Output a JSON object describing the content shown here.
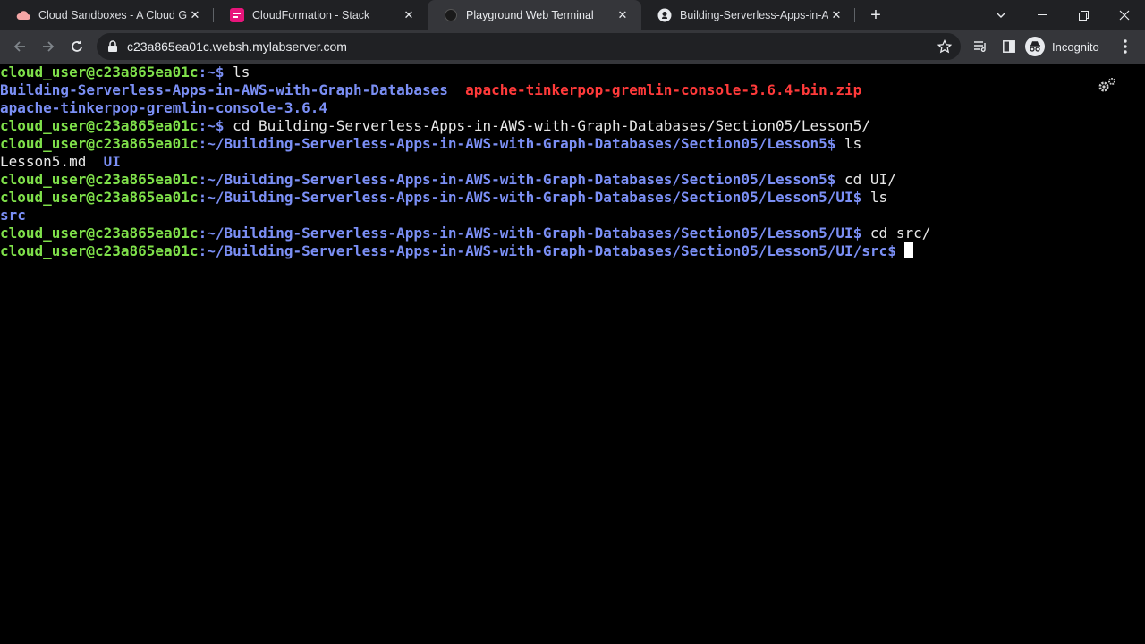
{
  "browser": {
    "tabs": [
      {
        "title": "Cloud Sandboxes - A Cloud Guru",
        "icon": "cloud-icon",
        "active": false
      },
      {
        "title": "CloudFormation - Stack",
        "icon": "cloudformation-icon",
        "active": false
      },
      {
        "title": "Playground Web Terminal",
        "icon": "terminal-favicon",
        "active": true
      },
      {
        "title": "Building-Serverless-Apps-in-AWS",
        "icon": "github-icon",
        "active": false
      }
    ],
    "url": "c23a865ea01c.websh.mylabserver.com",
    "profile_label": "Incognito"
  },
  "terminal": {
    "prompt": "cloud_user@c23a865ea01c",
    "lines": [
      {
        "path": ":~$ ",
        "cmd": "ls"
      },
      {
        "dir1": "Building-Serverless-Apps-in-AWS-with-Graph-Databases",
        "gap": "  ",
        "zip": "apache-tinkerpop-gremlin-console-3.6.4-bin.zip"
      },
      {
        "dir1": "apache-tinkerpop-gremlin-console-3.6.4"
      },
      {
        "path": ":~$ ",
        "cmd": "cd Building-Serverless-Apps-in-AWS-with-Graph-Databases/Section05/Lesson5/"
      },
      {
        "path": ":~/Building-Serverless-Apps-in-AWS-with-Graph-Databases/Section05/Lesson5$ ",
        "cmd": "ls"
      },
      {
        "file": "Lesson5.md",
        "gap": "  ",
        "dir1": "UI"
      },
      {
        "path": ":~/Building-Serverless-Apps-in-AWS-with-Graph-Databases/Section05/Lesson5$ ",
        "cmd": "cd UI/"
      },
      {
        "path": ":~/Building-Serverless-Apps-in-AWS-with-Graph-Databases/Section05/Lesson5/UI$ ",
        "cmd": "ls"
      },
      {
        "dir1": "src"
      },
      {
        "path": ":~/Building-Serverless-Apps-in-AWS-with-Graph-Databases/Section05/Lesson5/UI$ ",
        "cmd": "cd src/"
      },
      {
        "path": ":~/Building-Serverless-Apps-in-AWS-with-Graph-Databases/Section05/Lesson5/UI/src$ ",
        "cmd": ""
      }
    ]
  },
  "colors": {
    "prompt": "#7fe04a",
    "directory": "#7b8ff5",
    "archive": "#ff3a3a",
    "text": "#e8e8e8"
  }
}
